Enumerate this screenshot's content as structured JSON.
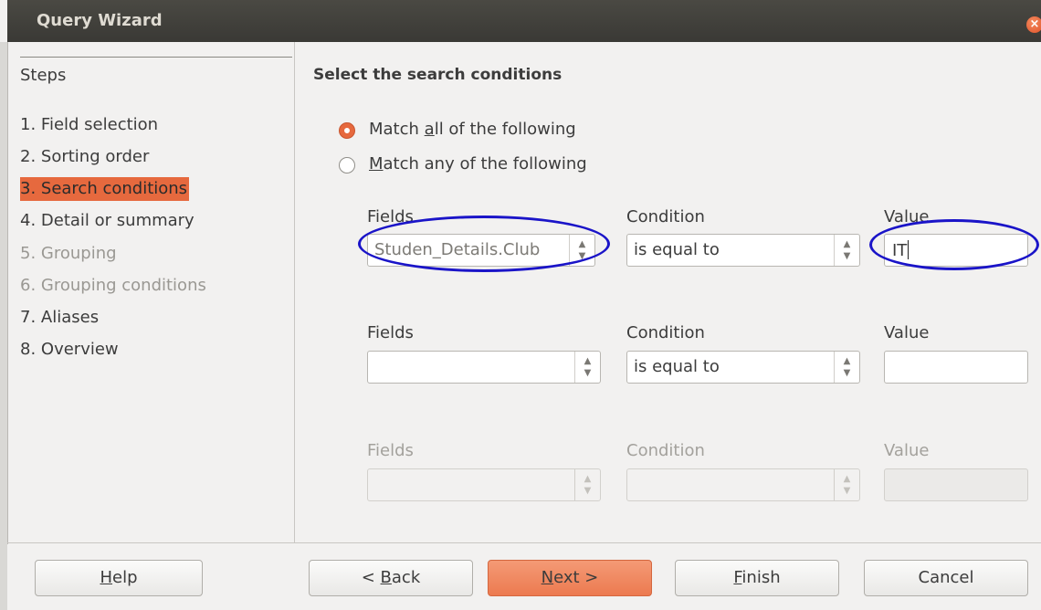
{
  "window": {
    "title": "Query Wizard",
    "close_glyph": "×"
  },
  "sidebar": {
    "title": "Steps",
    "items": [
      {
        "label": "1. Field selection",
        "state": "normal"
      },
      {
        "label": "2. Sorting order",
        "state": "normal"
      },
      {
        "label": "3. Search conditions",
        "state": "active"
      },
      {
        "label": "4. Detail or summary",
        "state": "normal"
      },
      {
        "label": "5. Grouping",
        "state": "disabled"
      },
      {
        "label": "6. Grouping conditions",
        "state": "disabled"
      },
      {
        "label": "7. Aliases",
        "state": "normal"
      },
      {
        "label": "8. Overview",
        "state": "normal"
      }
    ]
  },
  "main": {
    "heading": "Select the search conditions",
    "match": {
      "all": {
        "before": "Match ",
        "accel": "a",
        "after": "ll of the following",
        "selected": true
      },
      "any": {
        "accel": "M",
        "after": "atch any of the following",
        "selected": false
      }
    },
    "rows": [
      {
        "fields_label": "Fields",
        "condition_label": "Condition",
        "value_label": "Value",
        "field": "Studen_Details.Club",
        "condition": "is equal to",
        "value": "IT",
        "enabled": true
      },
      {
        "fields_label": "Fields",
        "condition_label": "Condition",
        "value_label": "Value",
        "field": "",
        "condition": "is equal to",
        "value": "",
        "enabled": true
      },
      {
        "fields_label": "Fields",
        "condition_label": "Condition",
        "value_label": "Value",
        "field": "",
        "condition": "",
        "value": "",
        "enabled": false
      }
    ]
  },
  "buttons": {
    "help": {
      "accel": "H",
      "rest": "elp"
    },
    "back": {
      "before": "< ",
      "accel": "B",
      "rest": "ack"
    },
    "next": {
      "accel": "N",
      "rest": "ext >"
    },
    "finish": {
      "accel": "F",
      "rest": "inish"
    },
    "cancel": "Cancel"
  },
  "colors": {
    "accent": "#e6693e",
    "annotation": "#1a14c8",
    "titlebar": "#3c3b37"
  }
}
